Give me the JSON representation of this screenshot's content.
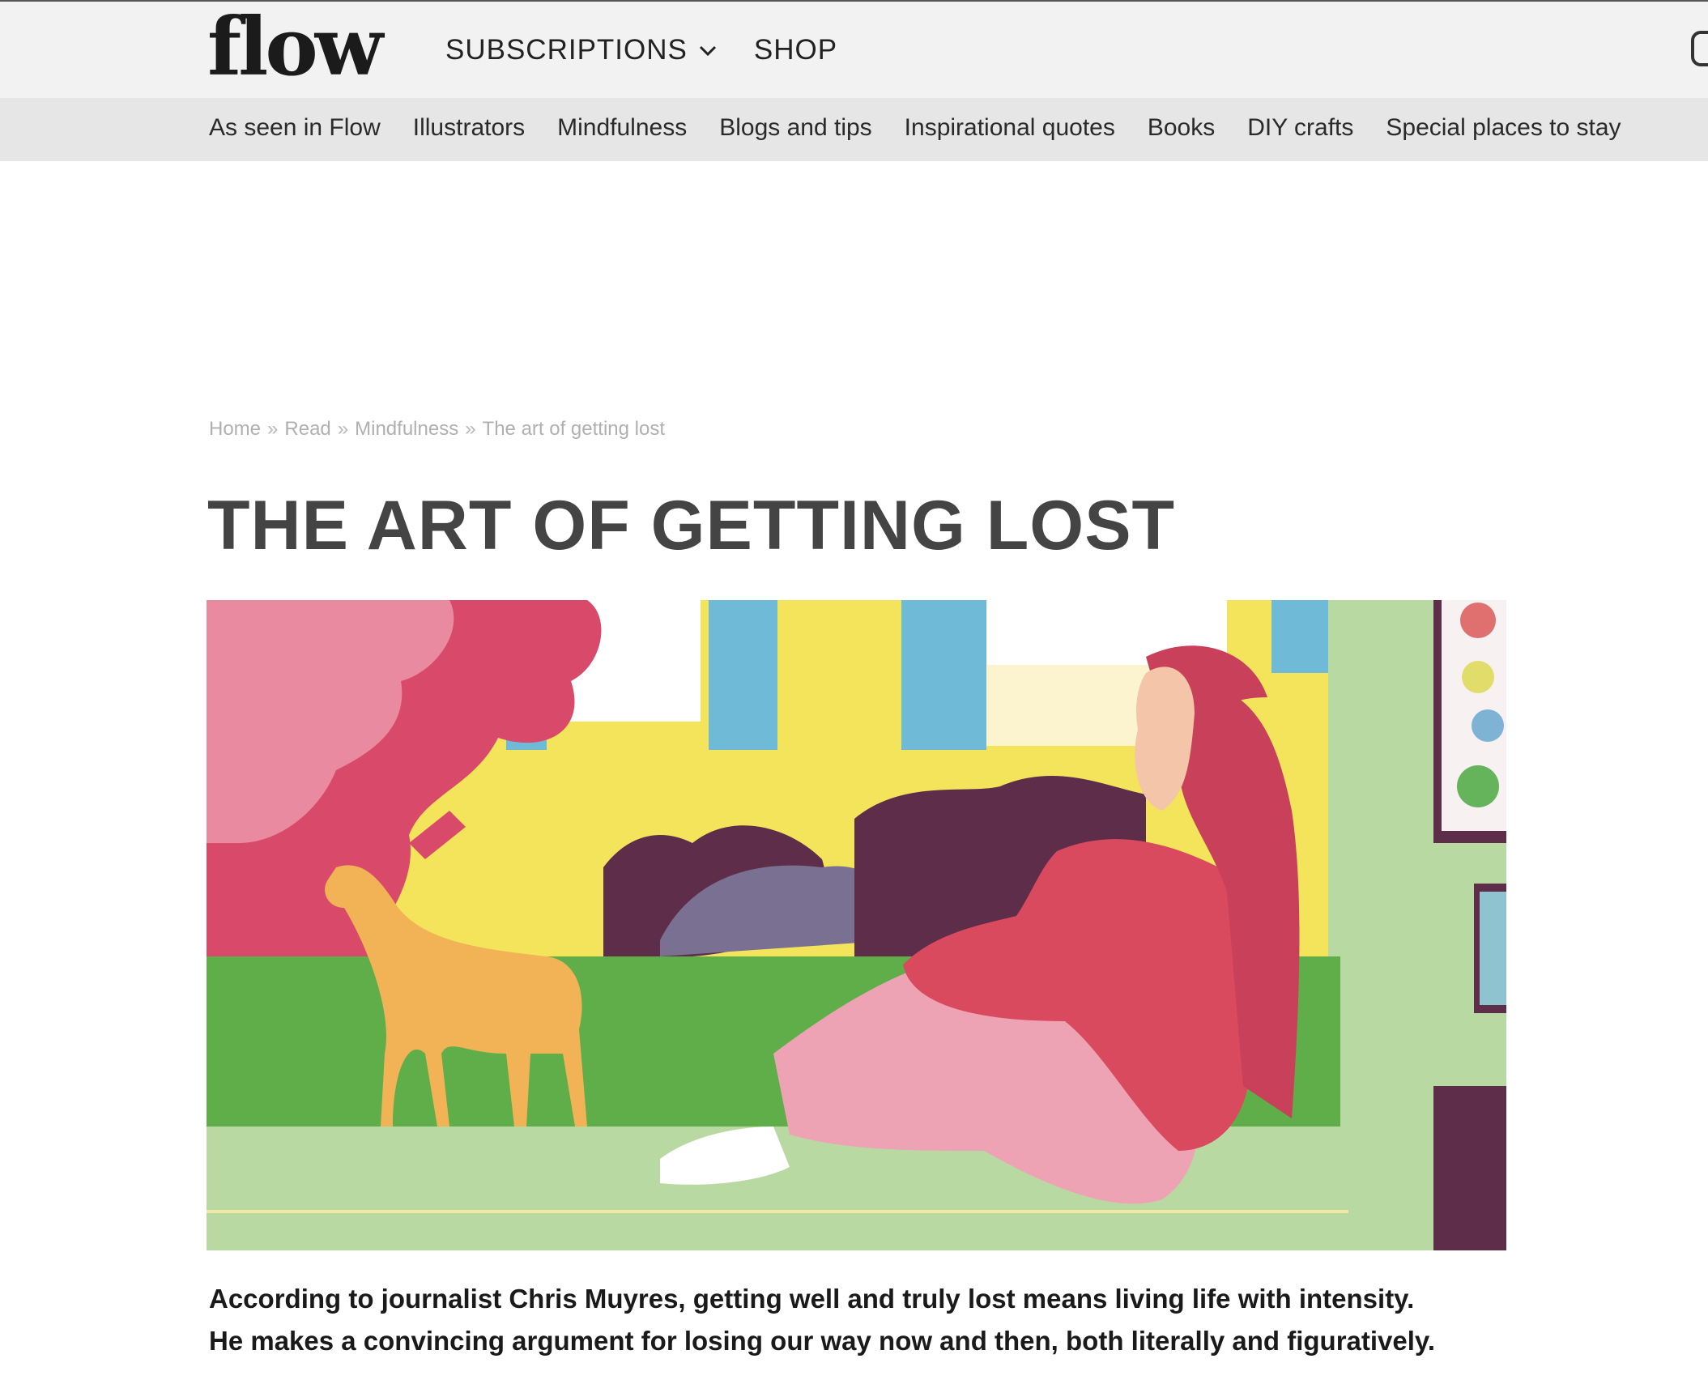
{
  "header": {
    "logo_text": "flow",
    "nav": [
      {
        "label": "SUBSCRIPTIONS",
        "icon": "chevron-down-icon"
      },
      {
        "label": "SHOP"
      }
    ],
    "right_icon": "instagram-icon"
  },
  "categories": [
    "As seen in Flow",
    "Illustrators",
    "Mindfulness",
    "Blogs and tips",
    "Inspirational quotes",
    "Books",
    "DIY crafts",
    "Special places to stay"
  ],
  "breadcrumb": {
    "items": [
      "Home",
      "Read",
      "Mindfulness",
      "The art of getting lost"
    ],
    "separator": "»"
  },
  "article": {
    "title": "THE ART OF GETTING LOST",
    "lead_line1": "According to journalist Chris Muyres, getting well and truly lost means living life with intensity.",
    "lead_line2": "He makes a convincing argument for losing our way now and then, both literally and figuratively."
  },
  "colors": {
    "header_bg": "#f2f2f2",
    "catbar_bg": "#e6e6e6",
    "title": "#444444",
    "breadcrumb": "#b0b0b0"
  }
}
